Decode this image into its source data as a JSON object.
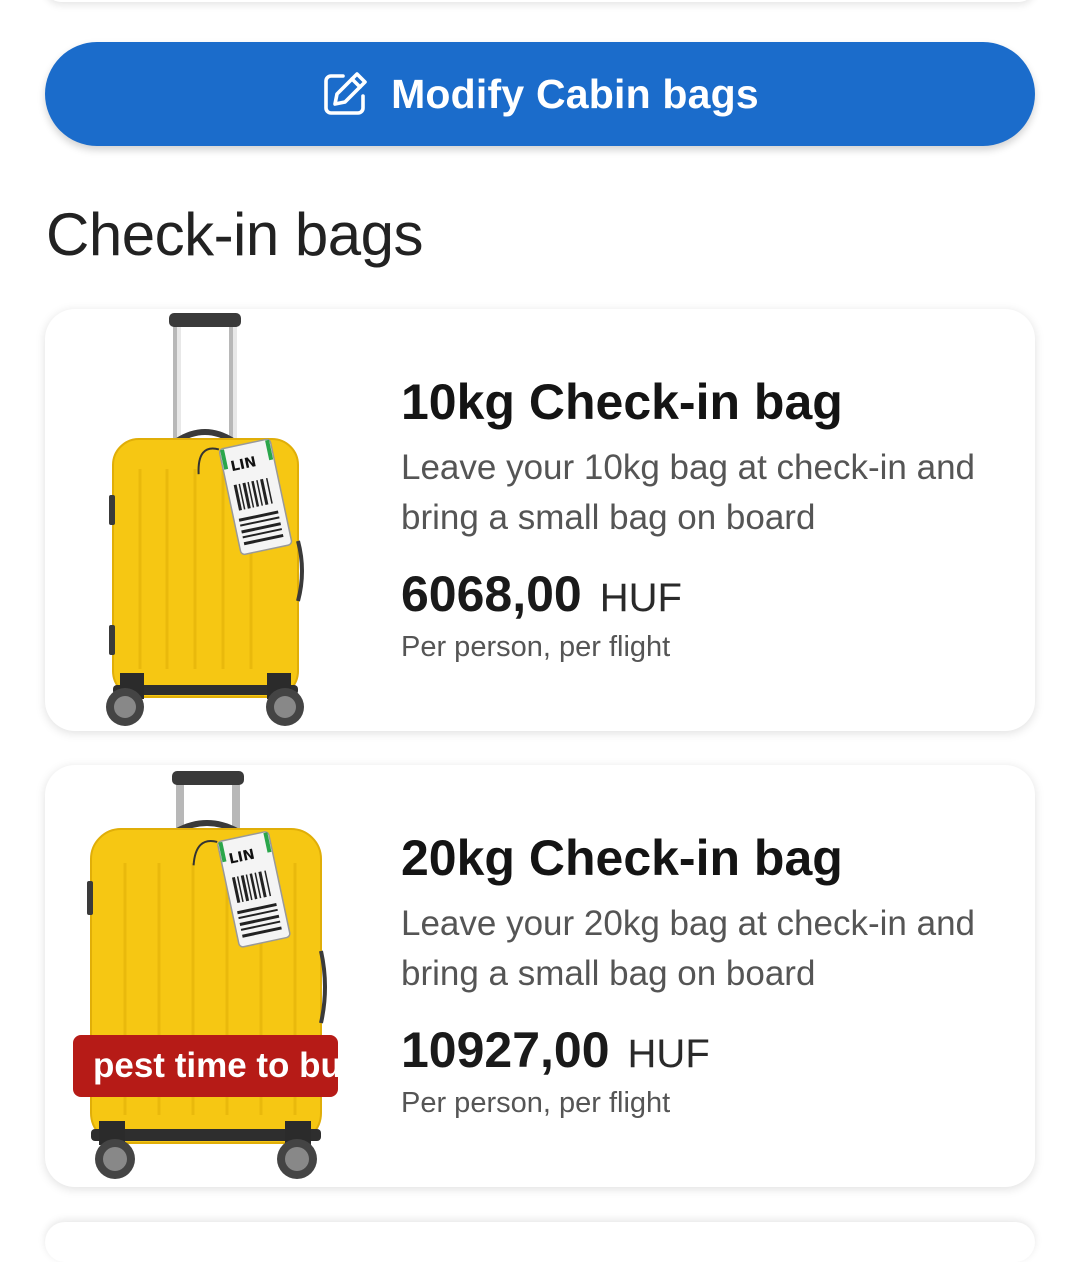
{
  "cabin": {
    "modify_label": "Modify Cabin bags",
    "icon": "edit-icon"
  },
  "checkin": {
    "section_title": "Check-in bags",
    "bags": [
      {
        "title": "10kg Check-in bag",
        "description": "Leave your 10kg bag at check-in and bring a small bag on board",
        "price": "6068,00",
        "currency": "HUF",
        "per": "Per person, per flight",
        "tag_code": "LIN"
      },
      {
        "title": "20kg Check-in bag",
        "description": "Leave your 20kg bag at check-in and bring a small bag on board",
        "price": "10927,00",
        "currency": "HUF",
        "per": "Per person, per flight",
        "tag_code": "LIN",
        "badge": "pest time to bu"
      }
    ]
  },
  "colors": {
    "primary": "#1b6ccb",
    "suitcase": "#f6c713",
    "badge": "#b61b17"
  }
}
